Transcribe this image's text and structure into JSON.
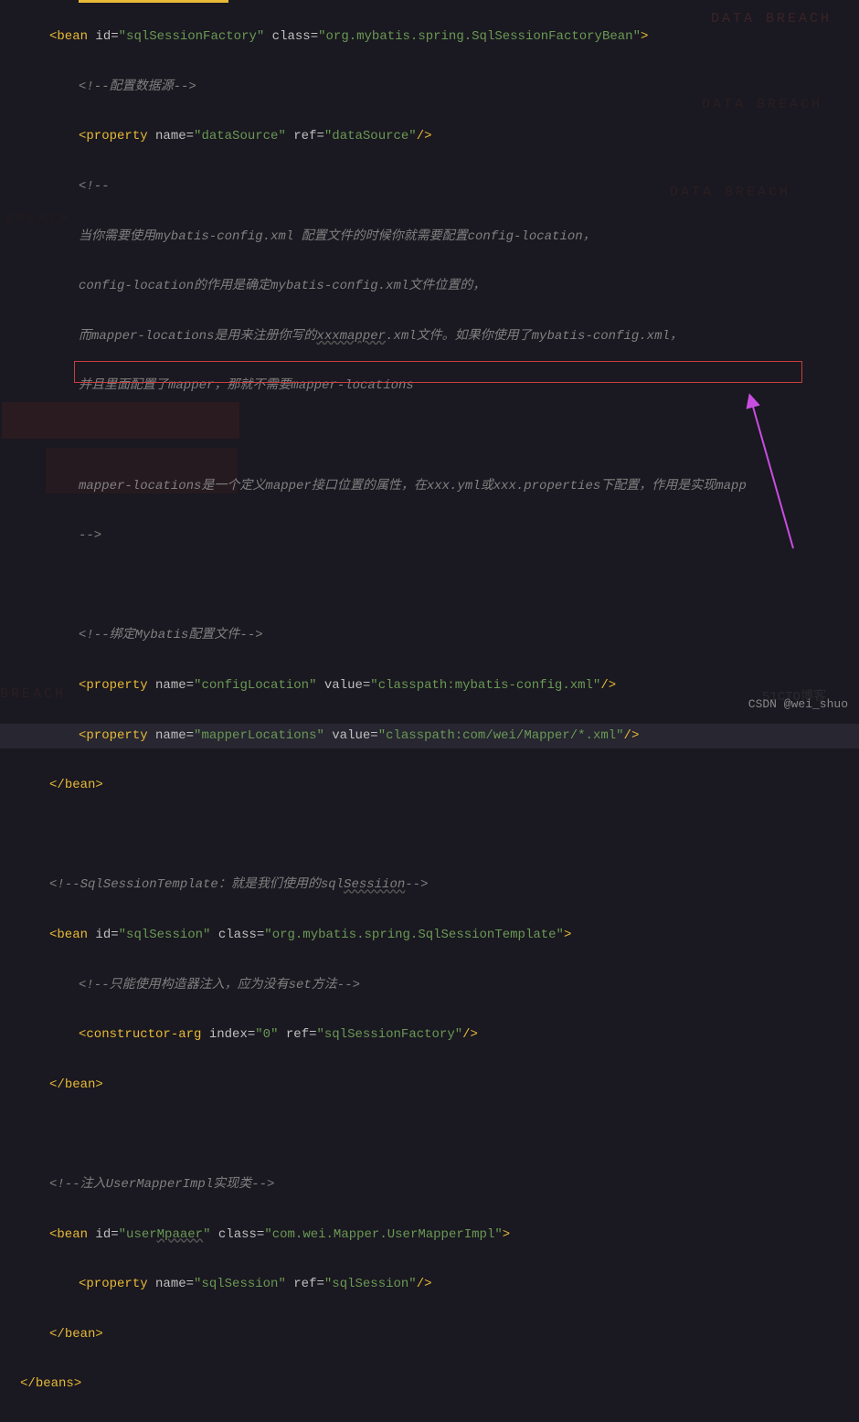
{
  "background_texts": {
    "b1": "DATA BREACH",
    "b2": "DATA BREACH",
    "b3": "DATA BREACH",
    "b4": "TA BREACH",
    "b5": "BREACH"
  },
  "watermark": "CSDN @wei_shuo",
  "faint_watermark": "51CTO博客",
  "code": {
    "l1_open": "<",
    "l1_tag": "bean",
    "l1_attr1": " id",
    "l1_eq": "=",
    "l1_val1": "\"sqlSessionFactory\"",
    "l1_attr2": " class",
    "l1_val2": "\"org.mybatis.spring.SqlSessionFactoryBean\"",
    "l1_close": ">",
    "l2": "<!--配置数据源-->",
    "l3_open": "<",
    "l3_tag": "property",
    "l3_attr1": " name",
    "l3_val1": "\"dataSource\"",
    "l3_attr2": " ref",
    "l3_val2": "\"dataSource\"",
    "l3_close": "/>",
    "l4": "<!--",
    "l5a": "当你需要使用mybatis-config.xml 配置文件的时候你就需要配置config-location，",
    "l5b": "config-location的作用是确定mybatis-config.xml文件位置的，",
    "l5c_a": "而mapper-locations是用来注册你写的",
    "l5c_u": "xxxmapper",
    "l5c_b": ".xml文件。如果你使用了mybatis-config.xml，",
    "l5d": "并且里面配置了mapper，那就不需要mapper-locations",
    "l6": "mapper-locations是一个定义mapper接口位置的属性，在xxx.yml或xxx.properties下配置，作用是实现mapp",
    "l7": "-->",
    "l8": "<!--绑定Mybatis配置文件-->",
    "l9_open": "<",
    "l9_tag": "property",
    "l9_attr1": " name",
    "l9_val1": "\"configLocation\"",
    "l9_attr2": " value",
    "l9_val2": "\"classpath:mybatis-config.xml\"",
    "l9_close": "/>",
    "l10_open": "<",
    "l10_tag": "property",
    "l10_attr1": " name",
    "l10_val1": "\"mapperLocations\"",
    "l10_attr2": " value",
    "l10_val2": "\"classpath:com/wei/Mapper/*.xml\"",
    "l10_close": "/>",
    "l11_open": "</",
    "l11_tag": "bean",
    "l11_close": ">",
    "l12a": "<!--SqlSessionTemplate：就是我们使用的sql",
    "l12b": "Sessiion",
    "l12c": "-->",
    "l13_open": "<",
    "l13_tag": "bean",
    "l13_attr1": " id",
    "l13_val1": "\"sqlSession\"",
    "l13_attr2": " class",
    "l13_val2": "\"org.mybatis.spring.SqlSessionTemplate\"",
    "l13_close": ">",
    "l14": "<!--只能使用构造器注入，应为没有set方法-->",
    "l15_open": "<",
    "l15_tag": "constructor-arg",
    "l15_attr1": " index",
    "l15_val1": "\"0\"",
    "l15_attr2": " ref",
    "l15_val2": "\"sqlSessionFactory\"",
    "l15_close": "/>",
    "l16_open": "</",
    "l16_tag": "bean",
    "l16_close": ">",
    "l17": "<!--注入UserMapperImpl实现类-->",
    "l18_open": "<",
    "l18_tag": "bean",
    "l18_attr1": " id",
    "l18_val1_a": "\"user",
    "l18_val1_u": "Mpaaer",
    "l18_val1_b": "\"",
    "l18_attr2": " class",
    "l18_val2": "\"com.wei.Mapper.UserMapperImpl\"",
    "l18_close": ">",
    "l19_open": "<",
    "l19_tag": "property",
    "l19_attr1": " name",
    "l19_val1": "\"sqlSession\"",
    "l19_attr2": " ref",
    "l19_val2": "\"sqlSession\"",
    "l19_close": "/>",
    "l20_open": "</",
    "l20_tag": "bean",
    "l20_close": ">",
    "l21_open": "</",
    "l21_tag": "beans",
    "l21_close": ">"
  }
}
